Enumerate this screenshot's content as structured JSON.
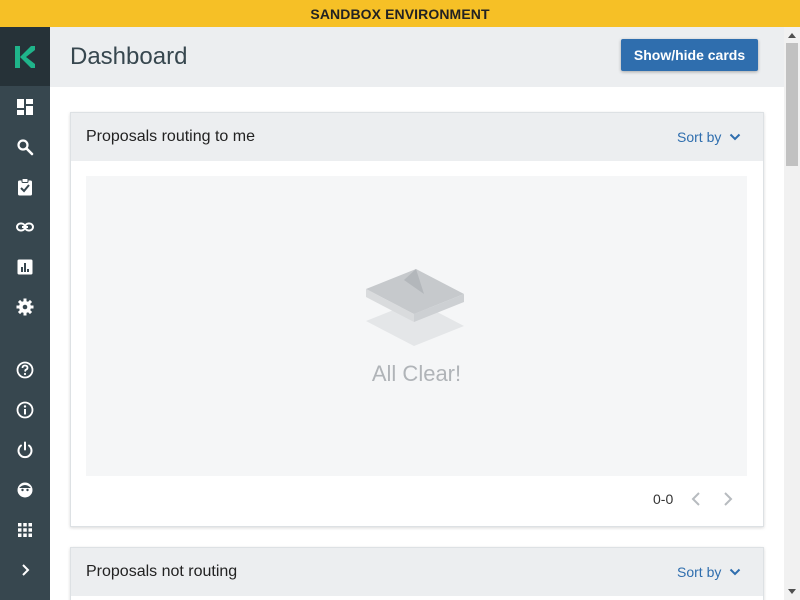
{
  "banner": {
    "text": "SANDBOX ENVIRONMENT"
  },
  "sidebar": {
    "logo": "kuali-logo",
    "items": [
      {
        "icon": "dashboard-icon"
      },
      {
        "icon": "search-icon"
      },
      {
        "icon": "clipboard-check-icon"
      },
      {
        "icon": "link-icon"
      },
      {
        "icon": "chart-icon"
      },
      {
        "icon": "gear-icon"
      },
      {
        "icon": "help-icon"
      },
      {
        "icon": "info-icon"
      },
      {
        "icon": "power-icon"
      },
      {
        "icon": "user-face-icon"
      },
      {
        "icon": "apps-grid-icon"
      },
      {
        "icon": "chevron-right-icon"
      }
    ]
  },
  "header": {
    "title": "Dashboard",
    "toggle_button": "Show/hide cards"
  },
  "cards": [
    {
      "title": "Proposals routing to me",
      "sort_label": "Sort by",
      "empty_text": "All Clear!",
      "pagination": "0-0"
    },
    {
      "title": "Proposals not routing",
      "sort_label": "Sort by"
    }
  ],
  "colors": {
    "banner": "#f6c026",
    "sidebar": "#37474f",
    "accent": "#2f6eae",
    "logo": "#1fb48a"
  }
}
